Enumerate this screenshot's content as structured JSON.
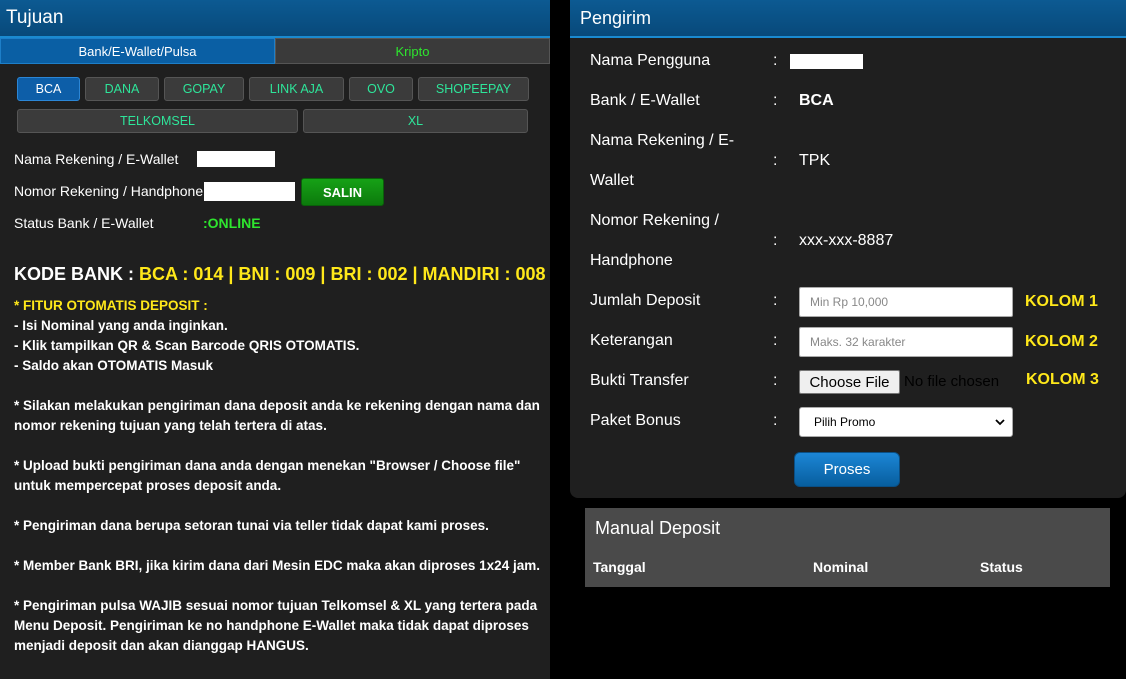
{
  "tujuan": {
    "title": "Tujuan",
    "tabs": [
      {
        "label": "Bank/E-Wallet/Pulsa"
      },
      {
        "label": "Kripto"
      }
    ],
    "banks_row1": [
      "BCA",
      "DANA",
      "GOPAY",
      "LINK AJA",
      "OVO",
      "SHOPEEPAY"
    ],
    "banks_row2": [
      "TELKOMSEL",
      "XL"
    ],
    "nama_label": "Nama Rekening / E-Wallet",
    "nomor_label": "Nomor Rekening / Handphone:",
    "salin_label": "SALIN",
    "status_label": "Status Bank / E-Wallet",
    "status_value": ":ONLINE",
    "kode_prefix": "KODE BANK : ",
    "kode_value": "BCA : 014 | BNI : 009 | BRI : 002 | MANDIRI : 008",
    "fitur_title": "* FITUR OTOMATIS DEPOSIT :",
    "fitur_lines": [
      "- Isi Nominal yang anda inginkan.",
      "- Klik tampilkan QR & Scan Barcode QRIS OTOMATIS.",
      "- Saldo akan OTOMATIS Masuk"
    ],
    "notes": [
      "* Silakan melakukan pengiriman dana deposit anda ke rekening dengan nama dan nomor rekening tujuan yang telah tertera di atas.",
      "* Upload bukti pengiriman dana anda dengan menekan \"Browser / Choose file\" untuk mempercepat proses deposit anda.",
      "* Pengiriman dana berupa setoran tunai via teller tidak dapat kami proses.",
      "* Member Bank BRI, jika kirim dana dari Mesin EDC maka akan diproses 1x24 jam.",
      "* Pengiriman pulsa WAJIB sesuai nomor tujuan Telkomsel & XL yang tertera pada Menu Deposit. Pengiriman ke no handphone E-Wallet maka tidak dapat diproses menjadi deposit dan akan dianggap HANGUS."
    ]
  },
  "pengirim": {
    "title": "Pengirim",
    "nama_pengguna_label": "Nama Pengguna",
    "bank_label": "Bank / E-Wallet",
    "bank_value": "BCA",
    "nama_rek_label_1": "Nama Rekening / E-",
    "nama_rek_label_2": "Wallet",
    "nama_rek_value": "TPK",
    "nomor_rek_label_1": "Nomor Rekening /",
    "nomor_rek_label_2": "Handphone",
    "nomor_rek_value": "xxx-xxx-8887",
    "jumlah_label": "Jumlah Deposit",
    "jumlah_placeholder": "Min Rp 10,000",
    "keterangan_label": "Keterangan",
    "keterangan_placeholder": "Maks. 32 karakter",
    "bukti_label": "Bukti Transfer",
    "choose_label": "Choose File",
    "nofile_label": "No file chosen",
    "paket_label": "Paket Bonus",
    "paket_value": "Pilih Promo",
    "kolom1": "KOLOM 1",
    "kolom2": "KOLOM 2",
    "kolom3": "KOLOM 3",
    "proses_label": "Proses",
    "colon": ":"
  },
  "manual": {
    "title": "Manual Deposit",
    "col_tanggal": "Tanggal",
    "col_nominal": "Nominal",
    "col_status": "Status"
  }
}
